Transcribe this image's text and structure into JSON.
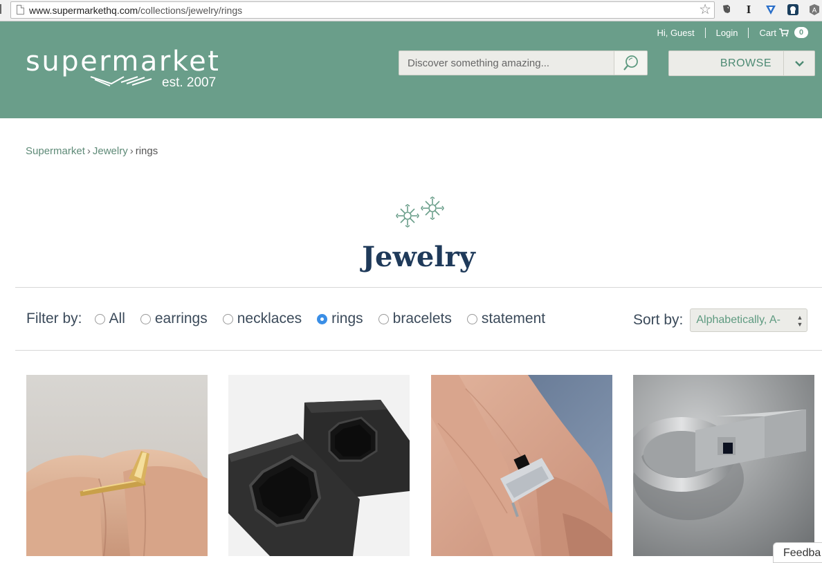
{
  "browser": {
    "url_domain": "www.supermarkethq.com",
    "url_path": "/collections/jewelry/rings"
  },
  "header": {
    "logo_word": "supermarket",
    "logo_est": "est. 2007",
    "greeting": "Hi, Guest",
    "login": "Login",
    "cart_label": "Cart",
    "cart_count": "0",
    "search_placeholder": "Discover something amazing...",
    "browse_label": "BROWSE"
  },
  "breadcrumb": {
    "items": [
      "Supermarket",
      "Jewelry",
      "rings"
    ],
    "separator": "›"
  },
  "page_title": "Jewelry",
  "filter": {
    "label": "Filter by:",
    "options": [
      "All",
      "earrings",
      "necklaces",
      "rings",
      "bracelets",
      "statement"
    ],
    "selected": "rings"
  },
  "sort": {
    "label": "Sort by:",
    "value": "Alphabetically, A-"
  },
  "products": [
    {
      "name": "gold-bar-ring"
    },
    {
      "name": "octagon-ring-molds"
    },
    {
      "name": "silver-onyx-ring-on-hand"
    },
    {
      "name": "silver-box-ring"
    }
  ],
  "feedback_label": "Feedba",
  "colors": {
    "header_bg": "#6a9e8a",
    "title_color": "#1f3a5a",
    "link_green": "#5e8a77",
    "radio_selected": "#3a8ee6"
  }
}
